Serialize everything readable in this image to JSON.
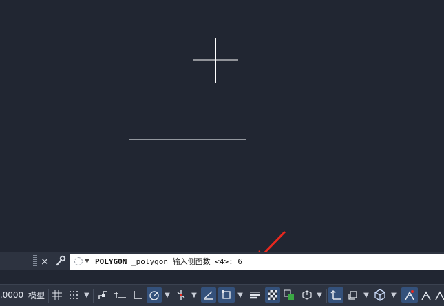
{
  "command_line": {
    "keyword": "POLYGON",
    "prompt": " _polygon 输入侧面数 <4>: ",
    "input_value": "6",
    "close_icon": "×",
    "settings_icon": "wrench-icon"
  },
  "status_bar": {
    "zoom_value": ".0000",
    "model_tab": "模型",
    "icons": [
      "grid-icon",
      "snap-grid-icon",
      "infer-icon",
      "dynamic-ucs-icon",
      "ortho-icon",
      "polar-icon",
      "osnap-track-icon",
      "lineweight-icon",
      "transparency-icon",
      "selection-cycling-icon",
      "3d-osnap-icon",
      "dynamic-input-icon",
      "annotation-scale-icon",
      "workspace-icon",
      "isolate-icon",
      "customize-icon"
    ]
  },
  "colors": {
    "canvas_bg": "#212632",
    "crosshair": "#ffffff",
    "arrow": "#e8281e",
    "active_toggle": "#34517b"
  }
}
